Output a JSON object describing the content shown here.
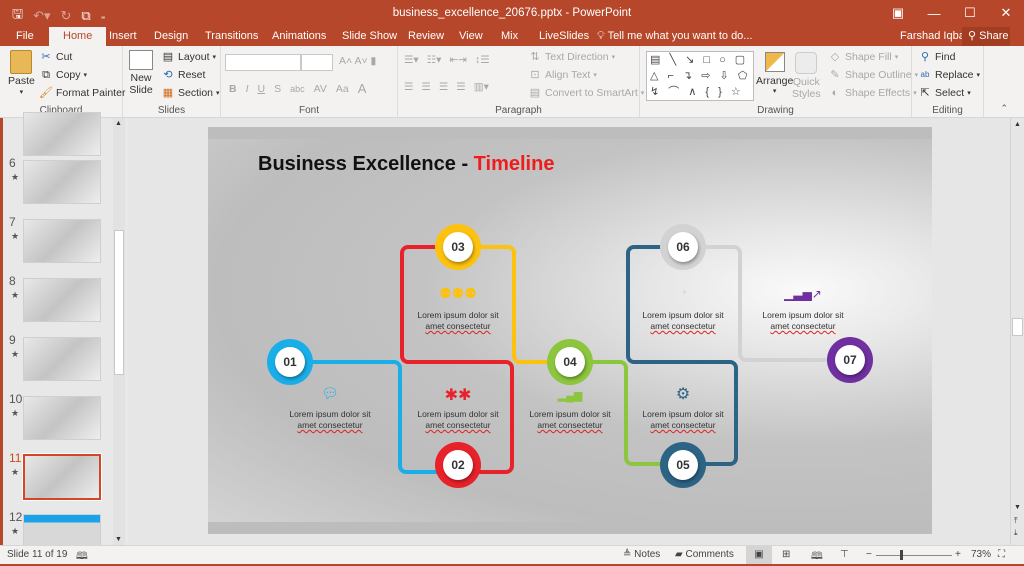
{
  "window": {
    "title": "business_excellence_20676.pptx - PowerPoint",
    "controls": [
      "ribbon-display",
      "minimize",
      "maximize",
      "close"
    ]
  },
  "qat": {
    "save": "save",
    "undo": "undo",
    "redo": "redo",
    "present": "start-from-beginning",
    "customize": "customize"
  },
  "tabs": [
    "File",
    "Home",
    "Insert",
    "Design",
    "Transitions",
    "Animations",
    "Slide Show",
    "Review",
    "View",
    "Mix",
    "LiveSlides"
  ],
  "active_tab": "Home",
  "tell_me": "Tell me what you want to do...",
  "user": "Farshad Iqbal",
  "share": "Share",
  "ribbon": {
    "clipboard": {
      "label": "Clipboard",
      "paste": "Paste",
      "cut": "Cut",
      "copy": "Copy",
      "format_painter": "Format Painter"
    },
    "slides": {
      "label": "Slides",
      "new_slide": "New",
      "new_slide2": "Slide",
      "layout": "Layout",
      "reset": "Reset",
      "section": "Section"
    },
    "font": {
      "label": "Font",
      "font_name": "",
      "font_size": "",
      "bold": "B",
      "italic": "I",
      "underline": "U",
      "shadow": "S",
      "strike": "abc",
      "spacing": "AV",
      "case": "Aa",
      "color": "A"
    },
    "paragraph": {
      "label": "Paragraph",
      "text_direction": "Text Direction",
      "align_text": "Align Text",
      "smartart": "Convert to SmartArt"
    },
    "drawing": {
      "label": "Drawing",
      "arrange": "Arrange",
      "quick_styles": "Quick",
      "quick_styles2": "Styles",
      "shape_fill": "Shape Fill",
      "shape_outline": "Shape Outline",
      "shape_effects": "Shape Effects",
      "shapes_row1": "▤ ╲ ↘ □ ○ ▢",
      "shapes_row2": "△ ⌐ ↴ ⇨ ⇩ ⬠",
      "shapes_row3": "↯ ⌒ ∧ { } ☆"
    },
    "editing": {
      "label": "Editing",
      "find": "Find",
      "replace": "Replace",
      "select": "Select"
    }
  },
  "thumbnails": [
    {
      "num": "6",
      "star": "★"
    },
    {
      "num": "7",
      "star": "★"
    },
    {
      "num": "8",
      "star": "★"
    },
    {
      "num": "9",
      "star": "★"
    },
    {
      "num": "10",
      "star": "★"
    },
    {
      "num": "11",
      "star": "★",
      "selected": true
    },
    {
      "num": "12",
      "star": "★"
    }
  ],
  "slide": {
    "title_black": "Business Excellence - ",
    "title_red": "Timeline",
    "steps": [
      {
        "num": "01",
        "color": "#1aaee8",
        "icon": "chat-icon",
        "glyph": "💬",
        "text1": "Lorem ipsum dolor sit",
        "text2": "amet consectetur"
      },
      {
        "num": "02",
        "color": "#e8222b",
        "icon": "puzzle-icon",
        "glyph": "🧩",
        "text1": "Lorem ipsum dolor sit",
        "text2": "amet consectetur"
      },
      {
        "num": "03",
        "color": "#fdc20f",
        "icon": "team-icon",
        "glyph": "👥",
        "text1": "Lorem ipsum dolor sit",
        "text2": "amet consectetur"
      },
      {
        "num": "04",
        "color": "#8cc63e",
        "icon": "bar-chart-icon",
        "glyph": "▂▄▆",
        "text1": "Lorem ipsum dolor sit",
        "text2": "amet consectetur"
      },
      {
        "num": "05",
        "color": "#2d6485",
        "icon": "gears-icon",
        "glyph": "⚙",
        "text1": "Lorem ipsum dolor sit",
        "text2": "amet consectetur"
      },
      {
        "num": "06",
        "color": "#d2d2d2",
        "icon": "pie-chart-icon",
        "glyph": "◔",
        "text1": "Lorem ipsum dolor sit",
        "text2": "amet consectetur"
      },
      {
        "num": "07",
        "color": "#7030a0",
        "icon": "growth-chart-icon",
        "glyph": "📈",
        "text1": "Lorem ipsum dolor sit",
        "text2": "amet consectetur"
      }
    ]
  },
  "status": {
    "slide_info": "Slide 11 of 19",
    "notes": "Notes",
    "comments": "Comments",
    "zoom": "73%",
    "zoom_level_percent": 73
  }
}
